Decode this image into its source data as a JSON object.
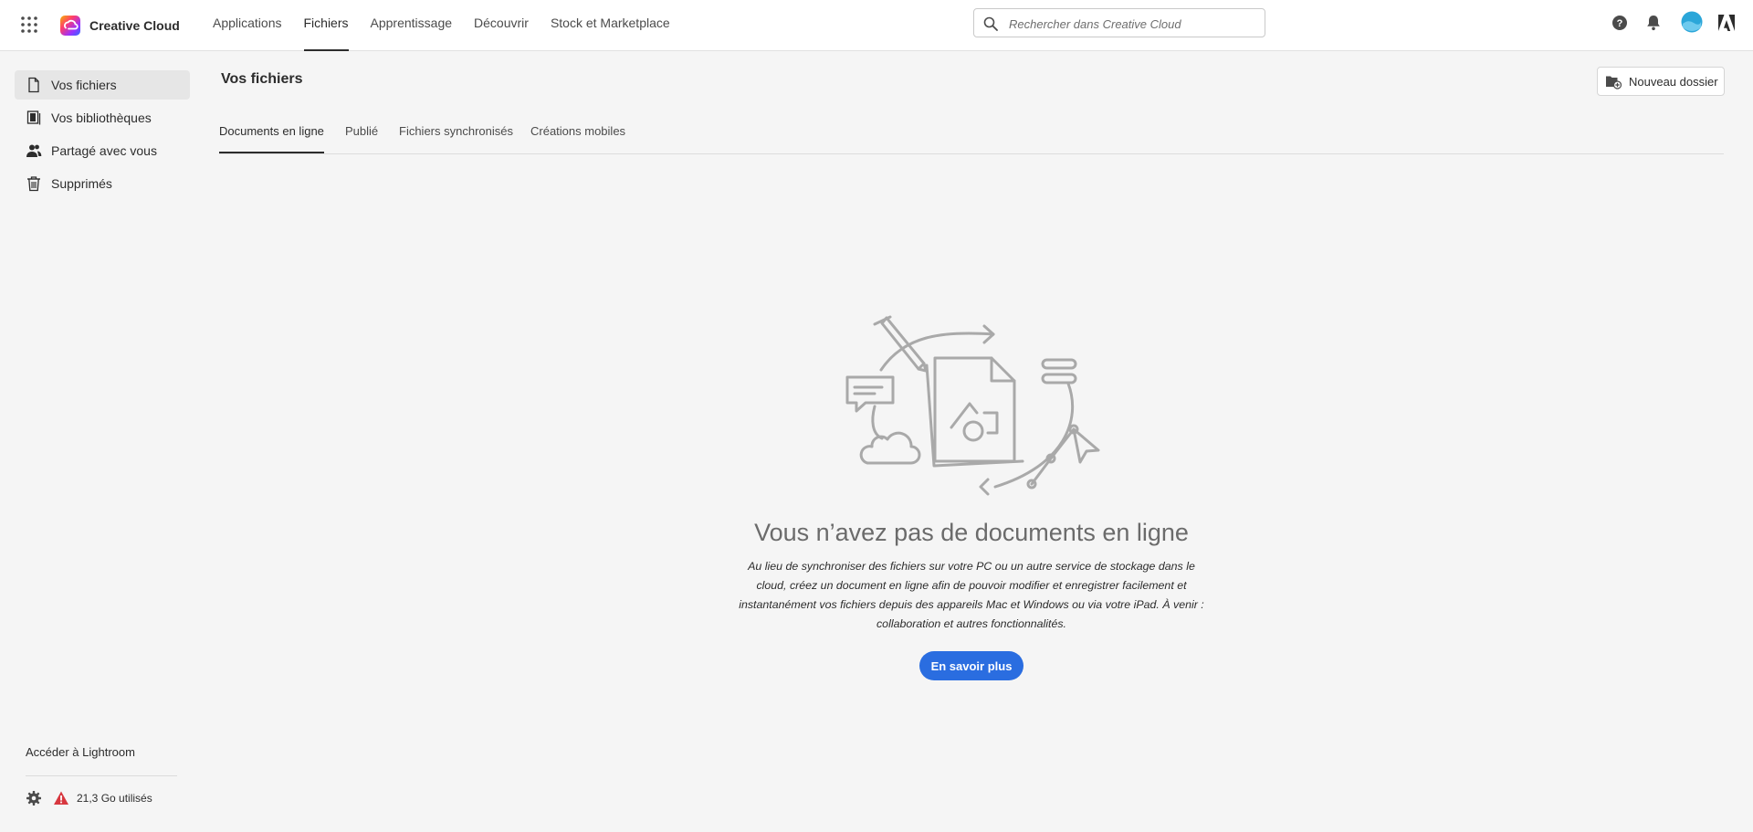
{
  "header": {
    "brand_name": "Creative Cloud",
    "nav": [
      {
        "label": "Applications"
      },
      {
        "label": "Fichiers"
      },
      {
        "label": "Apprentissage"
      },
      {
        "label": "Découvrir"
      },
      {
        "label": "Stock et Marketplace"
      }
    ],
    "active_nav": "Fichiers",
    "search_placeholder": "Rechercher dans Creative Cloud"
  },
  "sidebar": {
    "items": [
      {
        "label": "Vos fichiers",
        "icon": "file-icon"
      },
      {
        "label": "Vos bibliothèques",
        "icon": "library-icon"
      },
      {
        "label": "Partagé avec vous",
        "icon": "people-icon"
      },
      {
        "label": "Supprimés",
        "icon": "trash-icon"
      }
    ],
    "active_item": "Vos fichiers",
    "footer_link": "Accéder à Lightroom",
    "storage_text": "21,3 Go utilisés"
  },
  "main": {
    "title": "Vos fichiers",
    "new_folder_label": "Nouveau dossier",
    "tabs": [
      {
        "label": "Documents en ligne"
      },
      {
        "label": "Publié"
      },
      {
        "label": "Fichiers synchronisés"
      },
      {
        "label": "Créations mobiles"
      }
    ],
    "active_tab": "Documents en ligne",
    "empty_state": {
      "title": "Vous n’avez pas de documents en ligne",
      "description": "Au lieu de synchroniser des fichiers sur votre PC ou un autre service de stockage dans le cloud, créez un document en ligne afin de pouvoir modifier et enregistrer facilement et instantanément vos fichiers depuis des appareils Mac et Windows ou via votre iPad. À venir : collaboration et autres fonctionnalités.",
      "button_label": "En savoir plus"
    }
  },
  "colors": {
    "accent": "#2a6de0",
    "warning": "#d7373f",
    "avatar": "#2ba6d9"
  }
}
